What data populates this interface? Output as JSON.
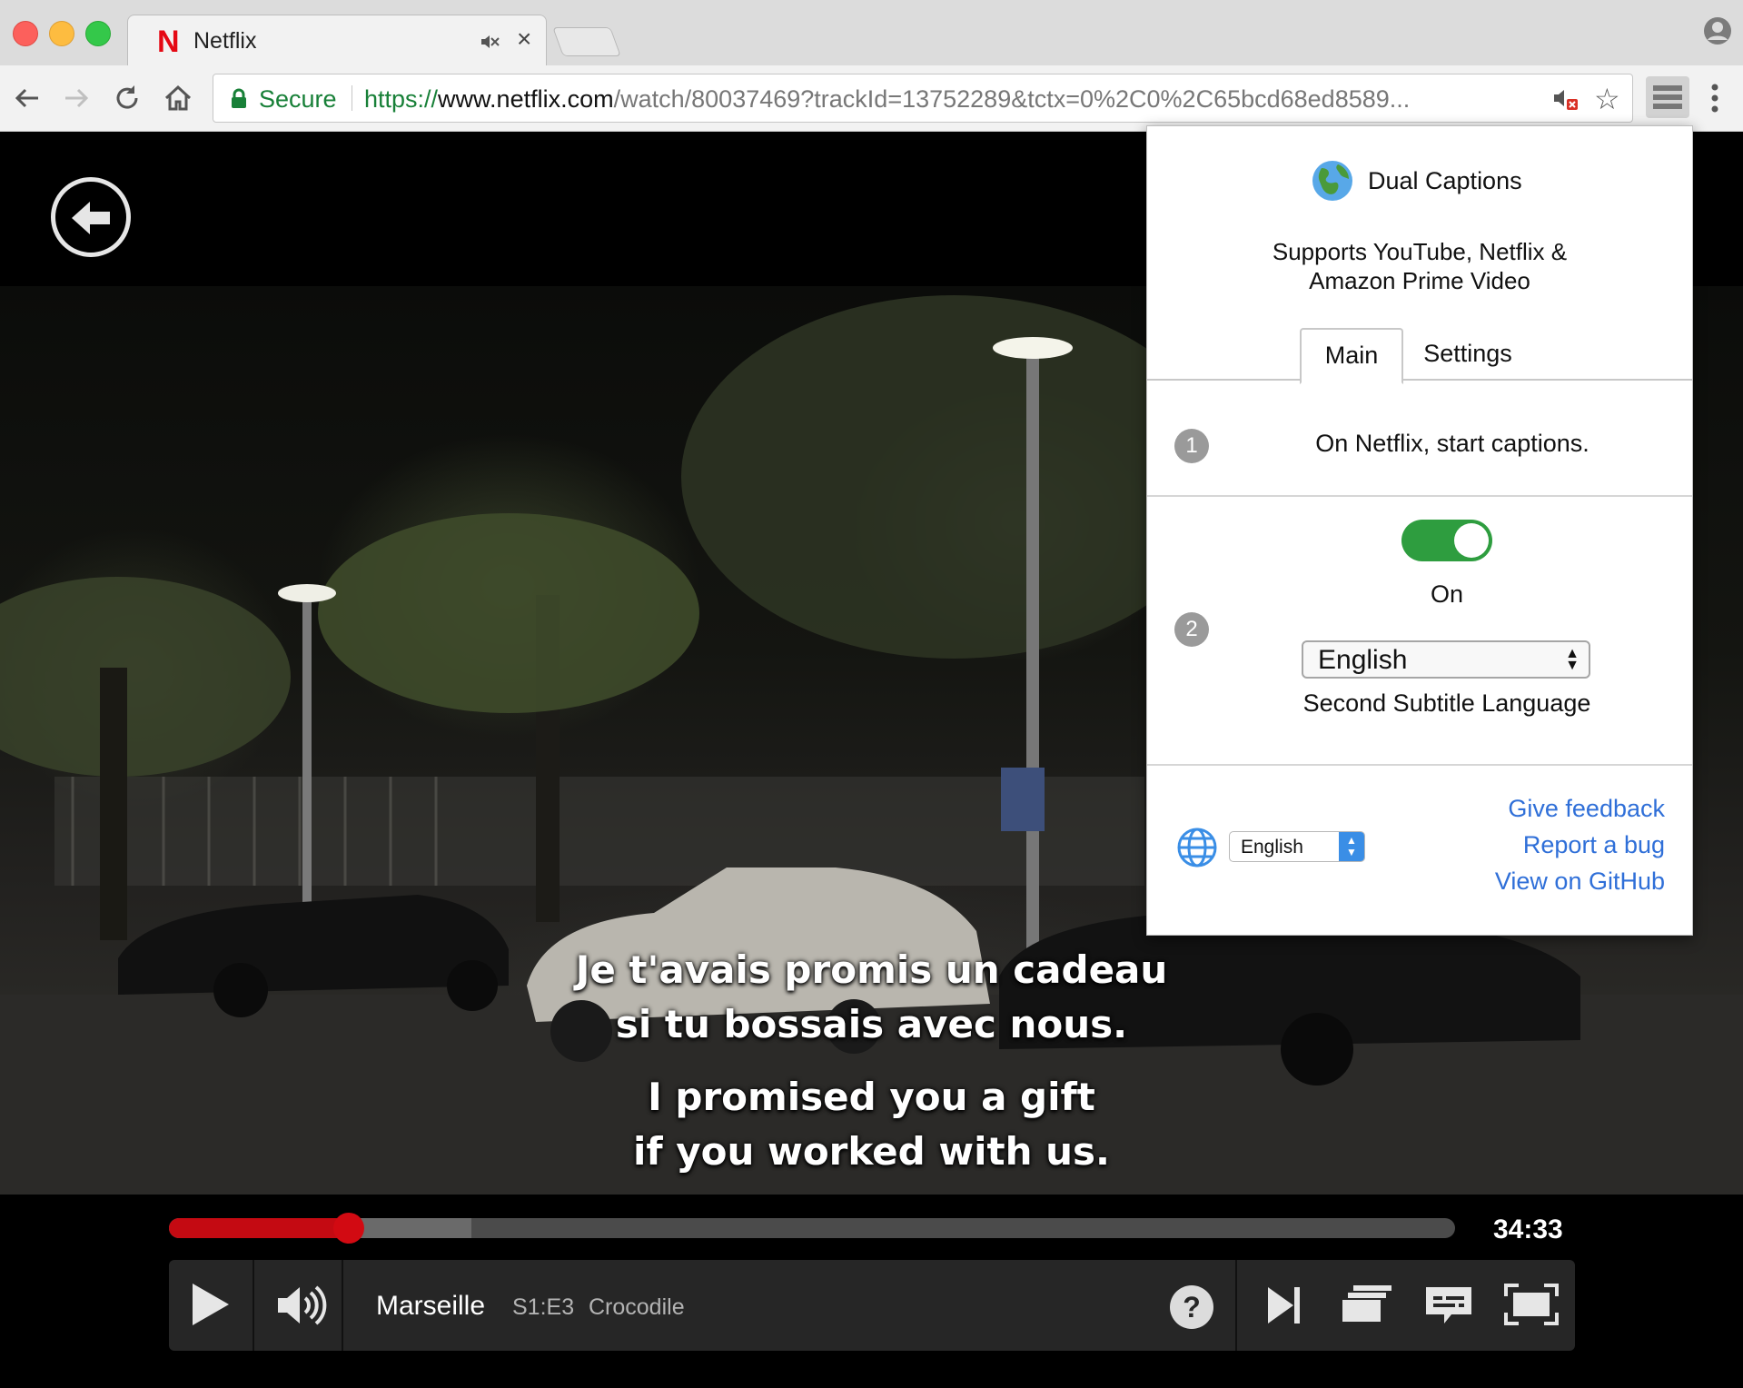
{
  "browser": {
    "tab": {
      "favicon": "N",
      "title": "Netflix",
      "mute_icon": "tab-muted-icon",
      "close": "×"
    },
    "toolbar": {
      "secure_label": "Secure",
      "url": {
        "scheme": "https://",
        "host": "www.netflix.com",
        "path": "/watch/80037469?trackId=13752289&tctx=0%2C0%2C65bcd68ed8589..."
      }
    },
    "icons": [
      "back-arrow-icon",
      "forward-arrow-icon",
      "reload-icon",
      "home-icon",
      "lock-icon",
      "muted-speaker-icon",
      "star-icon",
      "extension-icon",
      "menu-dots-icon",
      "profile-icon"
    ]
  },
  "player": {
    "subtitles_primary": [
      "Je t'avais promis un cadeau",
      "si tu bossais avec nous."
    ],
    "subtitles_secondary": [
      "I promised you a gift",
      "if you worked with us."
    ],
    "progress_fraction": 0.14,
    "buffered_fraction": 0.235,
    "time_remaining": "34:33",
    "show_title": "Marseille",
    "episode_id": "S1:E3",
    "episode_title": "Crocodile",
    "help_label": "?",
    "colors": {
      "progress": "#c40a12",
      "bar": "#262626"
    }
  },
  "popup": {
    "title": "Dual Captions",
    "subtitle_lines": [
      "Supports YouTube, Netflix &",
      "Amazon Prime Video"
    ],
    "tabs": [
      {
        "label": "Main",
        "active": true
      },
      {
        "label": "Settings",
        "active": false
      }
    ],
    "step1": {
      "number": "1",
      "text": "On Netflix, start captions."
    },
    "step2": {
      "number": "2",
      "toggle_on": true,
      "toggle_label": "On",
      "language": "English",
      "language_caption": "Second Subtitle Language"
    },
    "footer": {
      "ui_language": "English",
      "links": [
        "Give feedback",
        "Report a bug",
        "View on GitHub"
      ]
    },
    "colors": {
      "toggle": "#2e9d3f",
      "link": "#2f6fd8"
    }
  }
}
